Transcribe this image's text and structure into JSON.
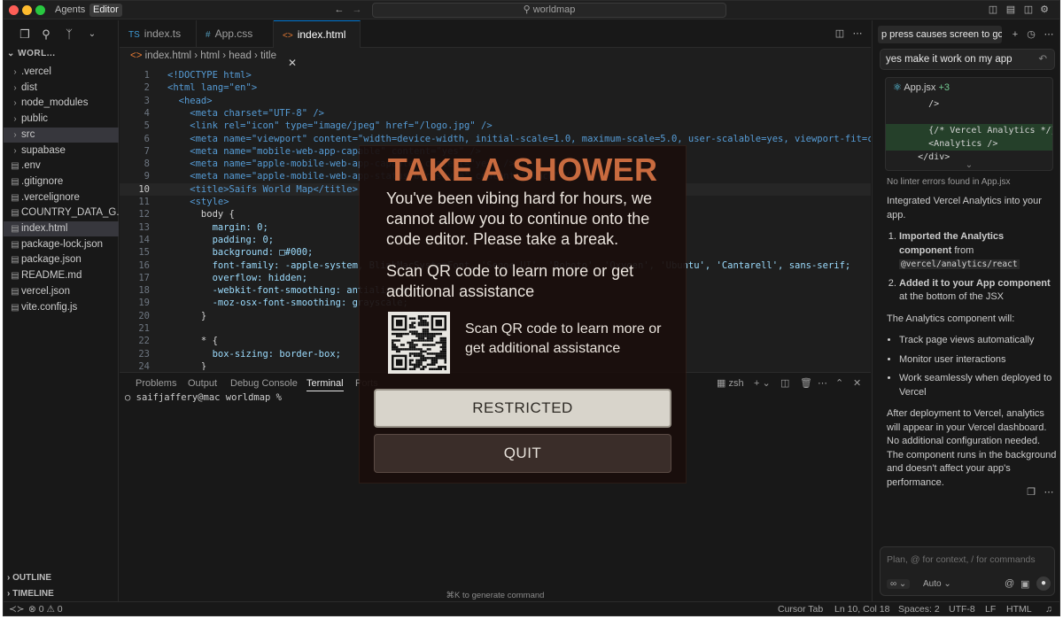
{
  "titlebar": {
    "tabs": [
      "Agents",
      "Editor"
    ],
    "search": "worldmap",
    "colors": {
      "close": "#ff5f57",
      "minimize": "#febc2e",
      "maximize": "#28c840"
    }
  },
  "sidebar": {
    "header": "WORL...",
    "items": [
      {
        "label": ".vercel",
        "type": "folder"
      },
      {
        "label": "dist",
        "type": "folder"
      },
      {
        "label": "node_modules",
        "type": "folder"
      },
      {
        "label": "public",
        "type": "folder"
      },
      {
        "label": "src",
        "type": "folder"
      },
      {
        "label": "supabase",
        "type": "folder"
      },
      {
        "label": ".env",
        "type": "file"
      },
      {
        "label": ".gitignore",
        "type": "file"
      },
      {
        "label": ".vercelignore",
        "type": "file"
      },
      {
        "label": "COUNTRY_DATA_G...",
        "type": "file"
      },
      {
        "label": "index.html",
        "type": "file"
      },
      {
        "label": "package-lock.json",
        "type": "file"
      },
      {
        "label": "package.json",
        "type": "file"
      },
      {
        "label": "README.md",
        "type": "file"
      },
      {
        "label": "vercel.json",
        "type": "file"
      },
      {
        "label": "vite.config.js",
        "type": "file"
      }
    ],
    "outline": "OUTLINE",
    "timeline": "TIMELINE"
  },
  "editor": {
    "tabs": [
      {
        "icon": "TS",
        "label": "index.ts"
      },
      {
        "icon": "#",
        "label": "App.css"
      },
      {
        "icon": "<>",
        "label": "index.html"
      }
    ],
    "breadcrumb": [
      "index.html",
      "html",
      "head",
      "title"
    ],
    "lines": [
      {
        "n": "1",
        "t": "<!DOCTYPE html>"
      },
      {
        "n": "2",
        "t": "<html lang=\"en\">"
      },
      {
        "n": "3",
        "t": "  <head>"
      },
      {
        "n": "4",
        "t": "    <meta charset=\"UTF-8\" />"
      },
      {
        "n": "5",
        "t": "    <link rel=\"icon\" type=\"image/jpeg\" href=\"/logo.jpg\" />"
      },
      {
        "n": "6",
        "t": "    <meta name=\"viewport\" content=\"width=device-width, initial-scale=1.0, maximum-scale=5.0, user-scalable=yes, viewport-fit=cover\" />"
      },
      {
        "n": "7",
        "t": "    <meta name=\"mobile-web-app-capable\" content=\"yes\" />"
      },
      {
        "n": "8",
        "t": "    <meta name=\"apple-mobile-web-app-capable\" content=\"yes\" />"
      },
      {
        "n": "9",
        "t": "    <meta name=\"apple-mobile-web-app-status-bar-style\" content=\"black\" />"
      },
      {
        "n": "10",
        "t": "    <title>Saifs World Map</title>"
      },
      {
        "n": "11",
        "t": "    <style>"
      },
      {
        "n": "12",
        "t": "      body {"
      },
      {
        "n": "13",
        "t": "        margin: 0;"
      },
      {
        "n": "14",
        "t": "        padding: 0;"
      },
      {
        "n": "15",
        "t": "        background: □#000;"
      },
      {
        "n": "16",
        "t": "        font-family: -apple-system, BlinkMacSystemFont, 'Segoe UI', 'Roboto', 'Oxygen', 'Ubuntu', 'Cantarell', sans-serif;"
      },
      {
        "n": "17",
        "t": "        overflow: hidden;"
      },
      {
        "n": "18",
        "t": "        -webkit-font-smoothing: antialiased;"
      },
      {
        "n": "19",
        "t": "        -moz-osx-font-smoothing: grayscale;"
      },
      {
        "n": "20",
        "t": "      }"
      },
      {
        "n": "21",
        "t": ""
      },
      {
        "n": "22",
        "t": "      * {"
      },
      {
        "n": "23",
        "t": "        box-sizing: border-box;"
      },
      {
        "n": "24",
        "t": "      }"
      }
    ],
    "current_line": "10"
  },
  "panel": {
    "tabs": [
      "Problems",
      "Output",
      "Debug Console",
      "Terminal",
      "Ports"
    ],
    "active": "Terminal",
    "shell": "zsh",
    "prompt": "○ saifjaffery@mac worldmap %",
    "hint": "⌘K to generate command"
  },
  "chat": {
    "title": "p press causes screen to go b",
    "user_message": "yes make it work on my app",
    "diff": {
      "file": "App.jsx",
      "added": "+3",
      "lines": [
        {
          "t": "        />",
          "add": false
        },
        {
          "t": "",
          "add": false
        },
        {
          "t": "        {/* Vercel Analytics */}",
          "add": true
        },
        {
          "t": "        <Analytics />",
          "add": true
        },
        {
          "t": "      </div>",
          "add": false
        }
      ]
    },
    "linter": "No linter errors found in App.jsx",
    "intro": "Integrated Vercel Analytics into your app.",
    "steps": [
      {
        "bold": "Imported the Analytics component",
        "rest": " from ",
        "code": "@vercel/analytics/react"
      },
      {
        "bold": "Added it to your App component",
        "rest": " at the bottom of the JSX",
        "code": ""
      }
    ],
    "will": "The Analytics component will:",
    "bullets": [
      "Track page views automatically",
      "Monitor user interactions",
      "Work seamlessly when deployed to Vercel"
    ],
    "outro": "After deployment to Vercel, analytics will appear in your Vercel dashboard. No additional configuration needed. The component runs in the background and doesn't affect your app's performance.",
    "input_placeholder": "Plan, @ for context, / for commands",
    "mode": "Auto"
  },
  "status": {
    "problems": "⊗ 0 ⚠ 0",
    "cursor_tab": "Cursor Tab",
    "position": "Ln 10, Col 18",
    "spaces": "Spaces: 2",
    "encoding": "UTF-8",
    "eol": "LF",
    "language": "HTML"
  },
  "modal": {
    "title": "TAKE A SHOWER",
    "message": "You've been vibing hard for hours, we cannot allow you to continue onto the code editor. Please take a break.",
    "scan_text": "Scan QR code to learn more or get additional assistance",
    "qr_text": "Scan QR code to learn more or get additional assistance",
    "primary_button": "RESTRICTED",
    "secondary_button": "QUIT",
    "title_color": "#c96b3f"
  }
}
